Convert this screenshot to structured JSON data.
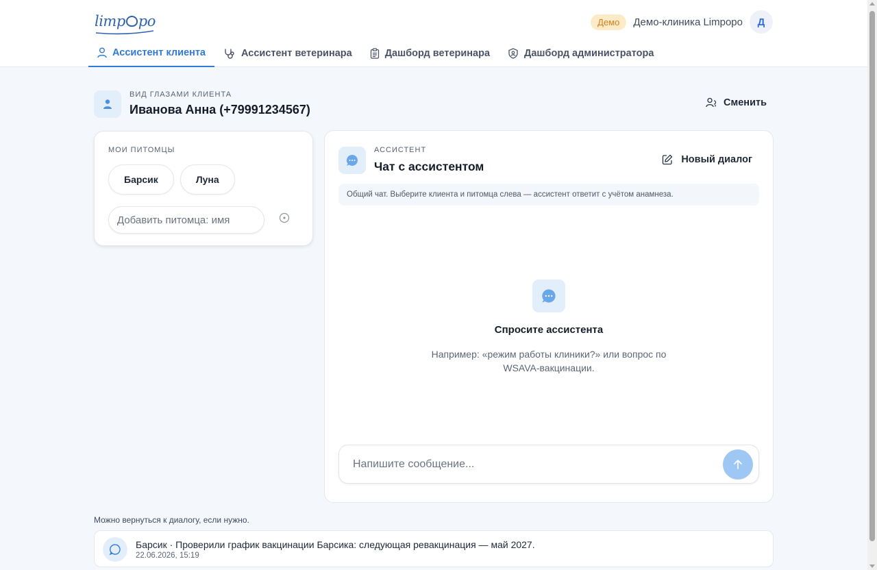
{
  "header": {
    "logo_prefix": "limp",
    "logo_suffix": "po",
    "demo_badge": "Демо",
    "clinic_name": "Демо-клиника Limpoро",
    "avatar_initial": "Д"
  },
  "tabs": [
    {
      "label": "Ассистент клиента",
      "icon": "user-icon",
      "active": true
    },
    {
      "label": "Ассистент ветеринара",
      "icon": "stethoscope-icon",
      "active": false
    },
    {
      "label": "Дашборд ветеринара",
      "icon": "clipboard-icon",
      "active": false
    },
    {
      "label": "Дашборд администратора",
      "icon": "shield-user-icon",
      "active": false
    }
  ],
  "client": {
    "overline": "Вид глазами клиента",
    "name": "Иванова Анна (+79991234567)",
    "switch_label": "Сменить"
  },
  "pets": {
    "title": "МОИ ПИТОМЦЫ",
    "items": [
      "Барсик",
      "Луна"
    ],
    "add_placeholder": "Добавить питомца: имя"
  },
  "chat": {
    "overline": "АССИСТЕНТ",
    "title": "Чат с ассистентом",
    "new_dialog_label": "Новый диалог",
    "notice": "Общий чат. Выберите клиента и питомца слева — ассистент ответит с учётом анамнеза.",
    "empty_title": "Спросите ассистента",
    "empty_hint": "Например: «режим работы клиники?» или вопрос по WSAVA-вакцинации.",
    "input_placeholder": "Напишите сообщение..."
  },
  "history": {
    "hint": "Можно вернуться к диалогу, если нужно.",
    "items": [
      {
        "text": "Барсик · Проверили график вакцинации Барсика: следующая ревакцинация — май 2027.",
        "time": "22.06.2026, 15:19"
      }
    ]
  },
  "colors": {
    "accent": "#2f7ad8",
    "demo_badge_bg": "#fdebc8",
    "demo_badge_text": "#d2811b",
    "send_button": "#9ec7f4"
  }
}
